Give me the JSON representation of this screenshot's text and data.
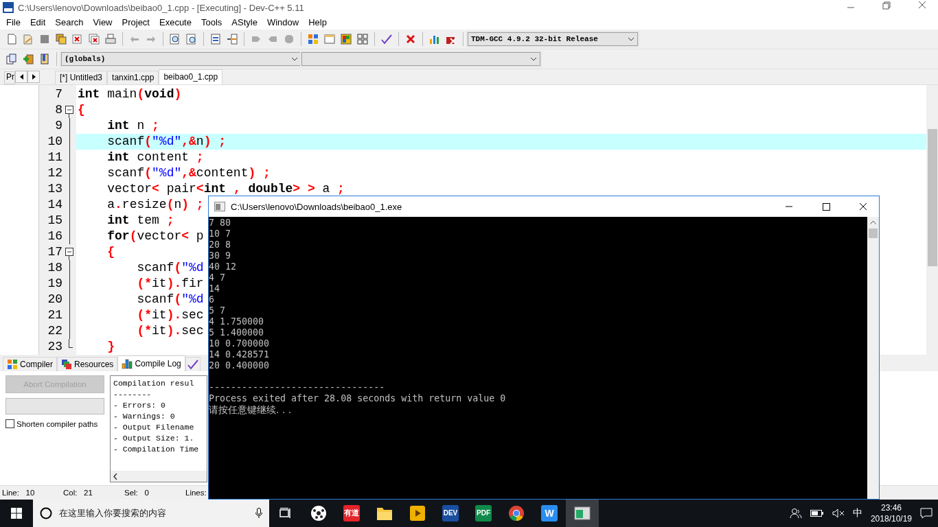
{
  "window": {
    "title": "C:\\Users\\lenovo\\Downloads\\beibao0_1.cpp - [Executing] - Dev-C++ 5.11"
  },
  "menu": [
    "File",
    "Edit",
    "Search",
    "View",
    "Project",
    "Execute",
    "Tools",
    "AStyle",
    "Window",
    "Help"
  ],
  "compiler_select": {
    "value": "TDM-GCC 4.9.2 32-bit Release"
  },
  "scope_select": {
    "value": "(globals)"
  },
  "tabs": {
    "panel_tab": "Pr",
    "files": [
      {
        "label": "[*] Untitled3",
        "selected": false
      },
      {
        "label": "tanxin1.cpp",
        "selected": false
      },
      {
        "label": "beibao0_1.cpp",
        "selected": true
      }
    ]
  },
  "editor": {
    "lines": [
      {
        "number": "7",
        "highlighted": false,
        "kind": "plain",
        "tokens": [
          {
            "kind": "kw",
            "text": "int"
          },
          {
            "kind": "id",
            "text": " main"
          },
          {
            "kind": "sym",
            "text": "("
          },
          {
            "kind": "kw",
            "text": "void"
          },
          {
            "kind": "sym",
            "text": ")"
          }
        ]
      },
      {
        "number": "8",
        "highlighted": false,
        "kind": "fold-start",
        "tokens": [
          {
            "kind": "sym",
            "text": "{"
          }
        ]
      },
      {
        "number": "9",
        "highlighted": false,
        "kind": "fold-body",
        "tokens": [
          {
            "kind": "kw",
            "text": "    int"
          },
          {
            "kind": "id",
            "text": " n "
          },
          {
            "kind": "sym",
            "text": ";"
          }
        ]
      },
      {
        "number": "10",
        "highlighted": true,
        "kind": "fold-body",
        "tokens": [
          {
            "kind": "id",
            "text": "    scanf"
          },
          {
            "kind": "sym",
            "text": "("
          },
          {
            "kind": "str",
            "text": "\"%d\""
          },
          {
            "kind": "sym",
            "text": ",&"
          },
          {
            "kind": "id",
            "text": "n"
          },
          {
            "kind": "sym",
            "text": ") ;"
          }
        ]
      },
      {
        "number": "11",
        "highlighted": false,
        "kind": "fold-body",
        "tokens": [
          {
            "kind": "kw",
            "text": "    int"
          },
          {
            "kind": "id",
            "text": " content "
          },
          {
            "kind": "sym",
            "text": ";"
          }
        ]
      },
      {
        "number": "12",
        "highlighted": false,
        "kind": "fold-body",
        "tokens": [
          {
            "kind": "id",
            "text": "    scanf"
          },
          {
            "kind": "sym",
            "text": "("
          },
          {
            "kind": "str",
            "text": "\"%d\""
          },
          {
            "kind": "sym",
            "text": ",&"
          },
          {
            "kind": "id",
            "text": "content"
          },
          {
            "kind": "sym",
            "text": ") ;"
          }
        ]
      },
      {
        "number": "13",
        "highlighted": false,
        "kind": "fold-body",
        "tokens": [
          {
            "kind": "id",
            "text": "    vector"
          },
          {
            "kind": "sym",
            "text": "<"
          },
          {
            "kind": "id",
            "text": " pair"
          },
          {
            "kind": "sym",
            "text": "<"
          },
          {
            "kind": "kw",
            "text": "int"
          },
          {
            "kind": "sym",
            "text": " , "
          },
          {
            "kind": "kw",
            "text": "double"
          },
          {
            "kind": "sym",
            "text": "> >"
          },
          {
            "kind": "id",
            "text": " a "
          },
          {
            "kind": "sym",
            "text": ";"
          }
        ]
      },
      {
        "number": "14",
        "highlighted": false,
        "kind": "fold-body",
        "tokens": [
          {
            "kind": "id",
            "text": "    a"
          },
          {
            "kind": "sym",
            "text": "."
          },
          {
            "kind": "id",
            "text": "resize"
          },
          {
            "kind": "sym",
            "text": "("
          },
          {
            "kind": "id",
            "text": "n"
          },
          {
            "kind": "sym",
            "text": ") ;"
          }
        ]
      },
      {
        "number": "15",
        "highlighted": false,
        "kind": "fold-body",
        "tokens": [
          {
            "kind": "kw",
            "text": "    int"
          },
          {
            "kind": "id",
            "text": " tem "
          },
          {
            "kind": "sym",
            "text": ";"
          }
        ]
      },
      {
        "number": "16",
        "highlighted": false,
        "kind": "fold-body",
        "tokens": [
          {
            "kind": "kw",
            "text": "    for"
          },
          {
            "kind": "sym",
            "text": "("
          },
          {
            "kind": "id",
            "text": "vector"
          },
          {
            "kind": "sym",
            "text": "<"
          },
          {
            "kind": "id",
            "text": " p"
          }
        ]
      },
      {
        "number": "17",
        "highlighted": false,
        "kind": "fold-start",
        "tokens": [
          {
            "kind": "sym",
            "text": "    {"
          }
        ]
      },
      {
        "number": "18",
        "highlighted": false,
        "kind": "fold-body",
        "tokens": [
          {
            "kind": "id",
            "text": "        scanf"
          },
          {
            "kind": "sym",
            "text": "("
          },
          {
            "kind": "str",
            "text": "\"%d"
          }
        ]
      },
      {
        "number": "19",
        "highlighted": false,
        "kind": "fold-body",
        "tokens": [
          {
            "kind": "sym",
            "text": "        (*"
          },
          {
            "kind": "id",
            "text": "it"
          },
          {
            "kind": "sym",
            "text": ")."
          },
          {
            "kind": "id",
            "text": "fir"
          }
        ]
      },
      {
        "number": "20",
        "highlighted": false,
        "kind": "fold-body",
        "tokens": [
          {
            "kind": "id",
            "text": "        scanf"
          },
          {
            "kind": "sym",
            "text": "("
          },
          {
            "kind": "str",
            "text": "\"%d"
          }
        ]
      },
      {
        "number": "21",
        "highlighted": false,
        "kind": "fold-body",
        "tokens": [
          {
            "kind": "sym",
            "text": "        (*"
          },
          {
            "kind": "id",
            "text": "it"
          },
          {
            "kind": "sym",
            "text": ")."
          },
          {
            "kind": "id",
            "text": "sec"
          }
        ]
      },
      {
        "number": "22",
        "highlighted": false,
        "kind": "fold-body",
        "tokens": [
          {
            "kind": "sym",
            "text": "        (*"
          },
          {
            "kind": "id",
            "text": "it"
          },
          {
            "kind": "sym",
            "text": ")."
          },
          {
            "kind": "id",
            "text": "sec"
          }
        ]
      },
      {
        "number": "23",
        "highlighted": false,
        "kind": "fold-end",
        "tokens": [
          {
            "kind": "sym",
            "text": "    }"
          }
        ]
      }
    ]
  },
  "bottom_panel": {
    "tabs": [
      {
        "kind": "compiler",
        "label": "Compiler",
        "selected": false
      },
      {
        "kind": "resources",
        "label": "Resources",
        "selected": false
      },
      {
        "kind": "log",
        "label": "Compile Log",
        "selected": true
      },
      {
        "kind": "debug",
        "selected": false
      }
    ],
    "abort_button": {
      "label": "Abort Compilation",
      "disabled": true
    },
    "progress": {
      "level": 0
    },
    "shorten_paths": {
      "label": "Shorten compiler paths",
      "checked": false
    },
    "log": [
      "Compilation resul",
      "--------",
      "- Errors: 0",
      "- Warnings: 0",
      "- Output Filename",
      "- Output Size: 1.",
      "- Compilation Time"
    ]
  },
  "status_bar": [
    {
      "label": "Line:",
      "value": "10"
    },
    {
      "label": "Col:",
      "value": "21"
    },
    {
      "label": "Sel:",
      "value": "0"
    },
    {
      "label": "Lines:"
    }
  ],
  "console": {
    "title": "C:\\Users\\lenovo\\Downloads\\beibao0_1.exe",
    "output": [
      "7 80",
      "10 7",
      "20 8",
      "30 9",
      "40 12",
      "4 7",
      "14",
      "6",
      "5 7",
      "4 1.750000",
      "5 1.400000",
      "10 0.700000",
      "14 0.428571",
      "20 0.400000"
    ],
    "separator": "--------------------------------",
    "message": "Process exited after 28.08 seconds with return value 0",
    "prompt": "请按任意键继续. . ."
  },
  "taskbar": {
    "search": {
      "placeholder": "在这里输入你要搜索的内容"
    },
    "apps": [
      {
        "kind": "game",
        "selected": false
      },
      {
        "kind": "dict",
        "label": "有道",
        "selected": false
      },
      {
        "kind": "folder",
        "selected": false
      },
      {
        "kind": "player",
        "selected": false
      },
      {
        "kind": "dev",
        "label": "DEV",
        "selected": false
      },
      {
        "kind": "pdf",
        "label": "PDF",
        "selected": false
      },
      {
        "kind": "browser",
        "selected": false
      },
      {
        "kind": "writer",
        "label": "W",
        "selected": false
      },
      {
        "kind": "console",
        "selected": true
      }
    ],
    "ime": "中",
    "time": "23:46",
    "date": "2018/10/19"
  }
}
